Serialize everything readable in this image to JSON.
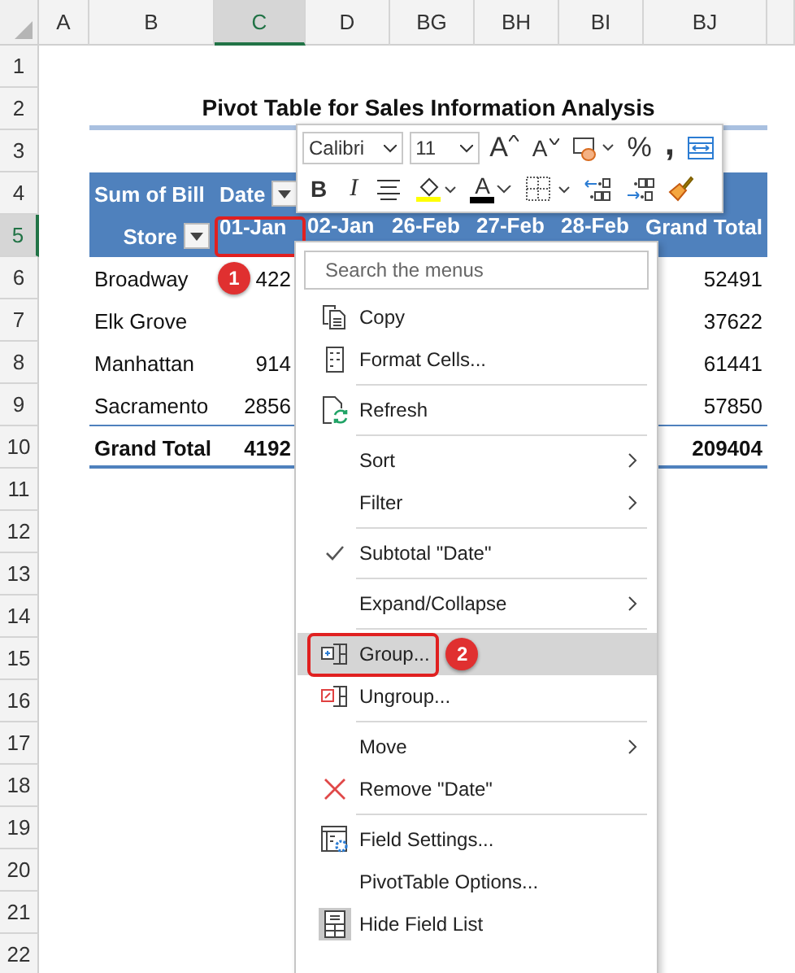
{
  "sheet": {
    "columns": [
      {
        "label": "A",
        "selected": false
      },
      {
        "label": "B",
        "selected": false
      },
      {
        "label": "C",
        "selected": true
      },
      {
        "label": "D",
        "selected": false
      },
      {
        "label": "BG",
        "selected": false
      },
      {
        "label": "BH",
        "selected": false
      },
      {
        "label": "BI",
        "selected": false
      },
      {
        "label": "BJ",
        "selected": false
      }
    ],
    "rows": [
      {
        "label": "1",
        "selected": false
      },
      {
        "label": "2",
        "selected": false
      },
      {
        "label": "3",
        "selected": false
      },
      {
        "label": "4",
        "selected": false
      },
      {
        "label": "5",
        "selected": true
      },
      {
        "label": "6",
        "selected": false
      },
      {
        "label": "7",
        "selected": false
      },
      {
        "label": "8",
        "selected": false
      },
      {
        "label": "9",
        "selected": false
      },
      {
        "label": "10",
        "selected": false
      },
      {
        "label": "11",
        "selected": false
      },
      {
        "label": "12",
        "selected": false
      },
      {
        "label": "13",
        "selected": false
      },
      {
        "label": "14",
        "selected": false
      },
      {
        "label": "15",
        "selected": false
      },
      {
        "label": "16",
        "selected": false
      },
      {
        "label": "17",
        "selected": false
      },
      {
        "label": "18",
        "selected": false
      },
      {
        "label": "19",
        "selected": false
      },
      {
        "label": "20",
        "selected": false
      },
      {
        "label": "21",
        "selected": false
      },
      {
        "label": "22",
        "selected": false
      }
    ]
  },
  "title": "Pivot Table for Sales Information Analysis",
  "pivot": {
    "value_field": "Sum of Bill",
    "column_field": "Date",
    "row_field": "Store",
    "column_headers": [
      {
        "text": "01-Jan",
        "callout": "1"
      },
      {
        "text": "02-Jan"
      },
      {
        "text": "26-Feb"
      },
      {
        "text": "27-Feb"
      },
      {
        "text": "28-Feb"
      },
      {
        "text": "Grand Total"
      }
    ],
    "rows": [
      {
        "store": "Broadway",
        "first": "422",
        "total": "52491"
      },
      {
        "store": "Elk Grove",
        "total": "37622"
      },
      {
        "store": "Manhattan",
        "first": "914",
        "total": "61441"
      },
      {
        "store": "Sacramento",
        "first": "2856",
        "total": "57850"
      }
    ],
    "grand_total": {
      "label": "Grand Total",
      "first": "4192",
      "total": "209404"
    }
  },
  "mini_toolbar": {
    "font": "Calibri",
    "size": "11",
    "row_1": [
      {
        "kind": "grow-font",
        "text": "A"
      },
      {
        "kind": "shrink-font",
        "text": "A"
      },
      {
        "kind": "number-format"
      },
      {
        "kind": "percent",
        "text": "%"
      },
      {
        "kind": "comma",
        "text": ","
      },
      {
        "kind": "merge"
      }
    ],
    "row_2": [
      {
        "kind": "bold",
        "text": "B"
      },
      {
        "kind": "italic",
        "text": "I"
      },
      {
        "kind": "align"
      },
      {
        "kind": "fill-color"
      },
      {
        "kind": "font-color",
        "text": "A"
      },
      {
        "kind": "borders"
      },
      {
        "kind": "increase-decimal"
      },
      {
        "kind": "decrease-decimal"
      },
      {
        "kind": "format-painter"
      }
    ]
  },
  "context_menu": {
    "search_placeholder": "Search the menus",
    "items": [
      {
        "label": "Copy",
        "kind": "copy",
        "submenu": false,
        "selected": false,
        "separator_before": false
      },
      {
        "label": "Format Cells...",
        "kind": "format",
        "submenu": false,
        "selected": false,
        "separator_before": false
      },
      {
        "label": "Refresh",
        "kind": "refresh",
        "submenu": false,
        "selected": false,
        "separator_before": true
      },
      {
        "label": "Sort",
        "kind": "plain",
        "submenu": true,
        "selected": false,
        "separator_before": true
      },
      {
        "label": "Filter",
        "kind": "plain",
        "submenu": true,
        "selected": false,
        "separator_before": false
      },
      {
        "label": "Subtotal \"Date\"",
        "kind": "check",
        "submenu": false,
        "selected": false,
        "separator_before": true
      },
      {
        "label": "Expand/Collapse",
        "kind": "plain",
        "submenu": true,
        "selected": false,
        "separator_before": true
      },
      {
        "label": "Group...",
        "kind": "group",
        "submenu": false,
        "selected": true,
        "callout": "2",
        "separator_before": true
      },
      {
        "label": "Ungroup...",
        "kind": "ungroup",
        "submenu": false,
        "selected": false,
        "separator_before": false
      },
      {
        "label": "Move",
        "kind": "plain",
        "submenu": true,
        "selected": false,
        "separator_before": true
      },
      {
        "label": "Remove \"Date\"",
        "kind": "remove",
        "submenu": false,
        "selected": false,
        "separator_before": false
      },
      {
        "label": "Field Settings...",
        "kind": "field-settings",
        "submenu": false,
        "selected": false,
        "separator_before": true
      },
      {
        "label": "PivotTable Options...",
        "kind": "plain",
        "submenu": false,
        "selected": false,
        "separator_before": false
      },
      {
        "label": "Hide Field List",
        "kind": "hide-field-list",
        "submenu": false,
        "selected": false,
        "separator_before": false
      }
    ]
  }
}
